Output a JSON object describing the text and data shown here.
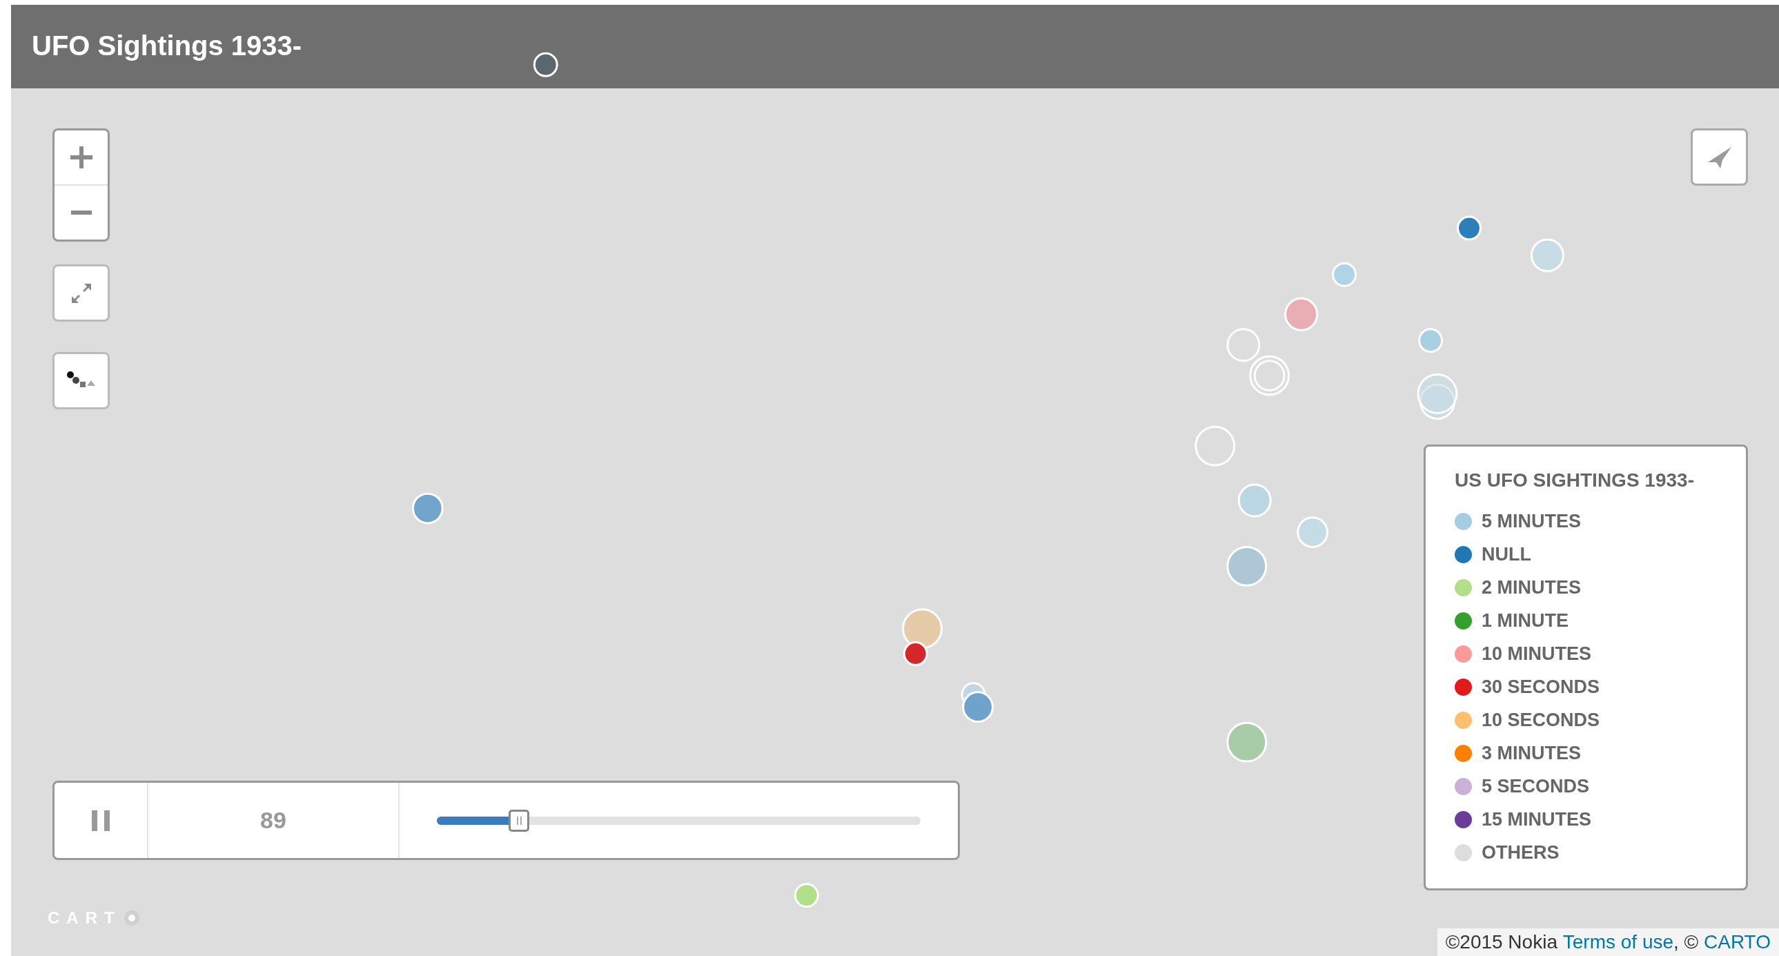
{
  "header": {
    "title": "UFO Sightings 1933-"
  },
  "timeline": {
    "playing": true,
    "step": "89",
    "level": 0.17
  },
  "legend": {
    "title": "US UFO SIGHTINGS 1933-",
    "items": [
      {
        "label": "5 MINUTES",
        "color": "#a6cee3"
      },
      {
        "label": "NULL",
        "color": "#1f78b4"
      },
      {
        "label": "2 MINUTES",
        "color": "#b2df8a"
      },
      {
        "label": "1 MINUTE",
        "color": "#33a02c"
      },
      {
        "label": "10 MINUTES",
        "color": "#fb9a99"
      },
      {
        "label": "30 SECONDS",
        "color": "#e31a1c"
      },
      {
        "label": "10 SECONDS",
        "color": "#fdbf6f"
      },
      {
        "label": "3 MINUTES",
        "color": "#ff7f00"
      },
      {
        "label": "5 SECONDS",
        "color": "#cab2d6"
      },
      {
        "label": "15 MINUTES",
        "color": "#6a3d9a"
      },
      {
        "label": "OTHERS",
        "color": "#dddddd"
      }
    ]
  },
  "logo": "CART",
  "attribution": [
    {
      "kind": "text",
      "text": "©2015 Nokia "
    },
    {
      "kind": "link",
      "text": "Terms of use"
    },
    {
      "kind": "text",
      "text": ", © "
    },
    {
      "kind": "link",
      "text": "CARTO"
    }
  ]
}
